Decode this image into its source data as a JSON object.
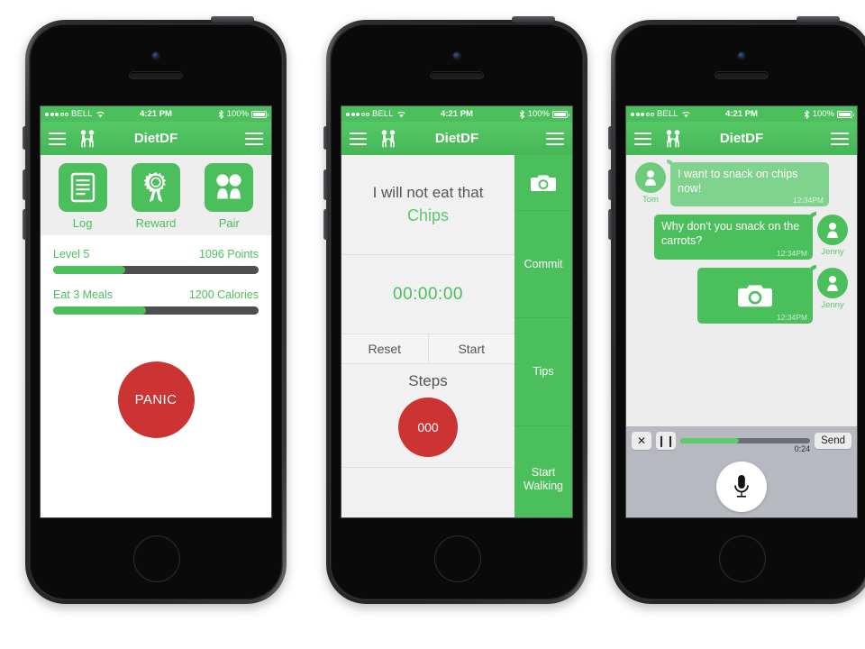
{
  "statusbar": {
    "carrier": "BELL",
    "time": "4:21 PM",
    "battery_pct": "100%",
    "signal_filled": 3,
    "signal_empty": 2,
    "wifi_icon": "wifi-icon",
    "bluetooth_icon": "bluetooth-icon"
  },
  "navbar": {
    "title": "DietDF",
    "left_icon": "hamburger-menu-icon",
    "people_icon": "two-people-icon",
    "right_icon": "hamburger-menu-icon"
  },
  "colors": {
    "green": "#4cbf5d",
    "green_light": "#7fd38c",
    "red": "#cc3333",
    "chat_bg": "#ededed",
    "audio_bg": "#b6bac0"
  },
  "phone1": {
    "tiles": [
      {
        "label": "Log",
        "icon": "document-icon"
      },
      {
        "label": "Reward",
        "icon": "award-ribbon-icon"
      },
      {
        "label": "Pair",
        "icon": "two-people-icon"
      }
    ],
    "progress": [
      {
        "left_label": "Level 5",
        "right_label": "1096 Points",
        "percent": 35
      },
      {
        "left_label": "Eat 3 Meals",
        "right_label": "1200 Calories",
        "percent": 45
      }
    ],
    "panic_label": "PANIC"
  },
  "phone2": {
    "commit_line1": "I will not eat that",
    "commit_line2": "Chips",
    "timer": "00:00:00",
    "reset_label": "Reset",
    "start_label": "Start",
    "steps_title": "Steps",
    "steps_count": "000",
    "side_items": [
      {
        "label": "",
        "icon": "camera-icon"
      },
      {
        "label": "Commit",
        "icon": ""
      },
      {
        "label": "Tips",
        "icon": ""
      },
      {
        "label": "Start Walking",
        "icon": ""
      }
    ]
  },
  "phone3": {
    "messages": [
      {
        "side": "left",
        "sender": "Tom",
        "text": "I want to snack on chips now!",
        "time": "12:34PM",
        "kind": "text",
        "tone": "light"
      },
      {
        "side": "right",
        "sender": "Jenny",
        "text": "Why don't you snack on the carrots?",
        "time": "12:34PM",
        "kind": "text",
        "tone": "dark"
      },
      {
        "side": "right",
        "sender": "Jenny",
        "text": "",
        "time": "12:34PM",
        "kind": "photo",
        "tone": "dark",
        "icon": "camera-icon"
      }
    ],
    "audio": {
      "close_icon": "close-icon",
      "pause_icon": "pause-icon",
      "elapsed": "0:24",
      "percent": 45,
      "send_label": "Send",
      "mic_icon": "microphone-icon"
    }
  }
}
